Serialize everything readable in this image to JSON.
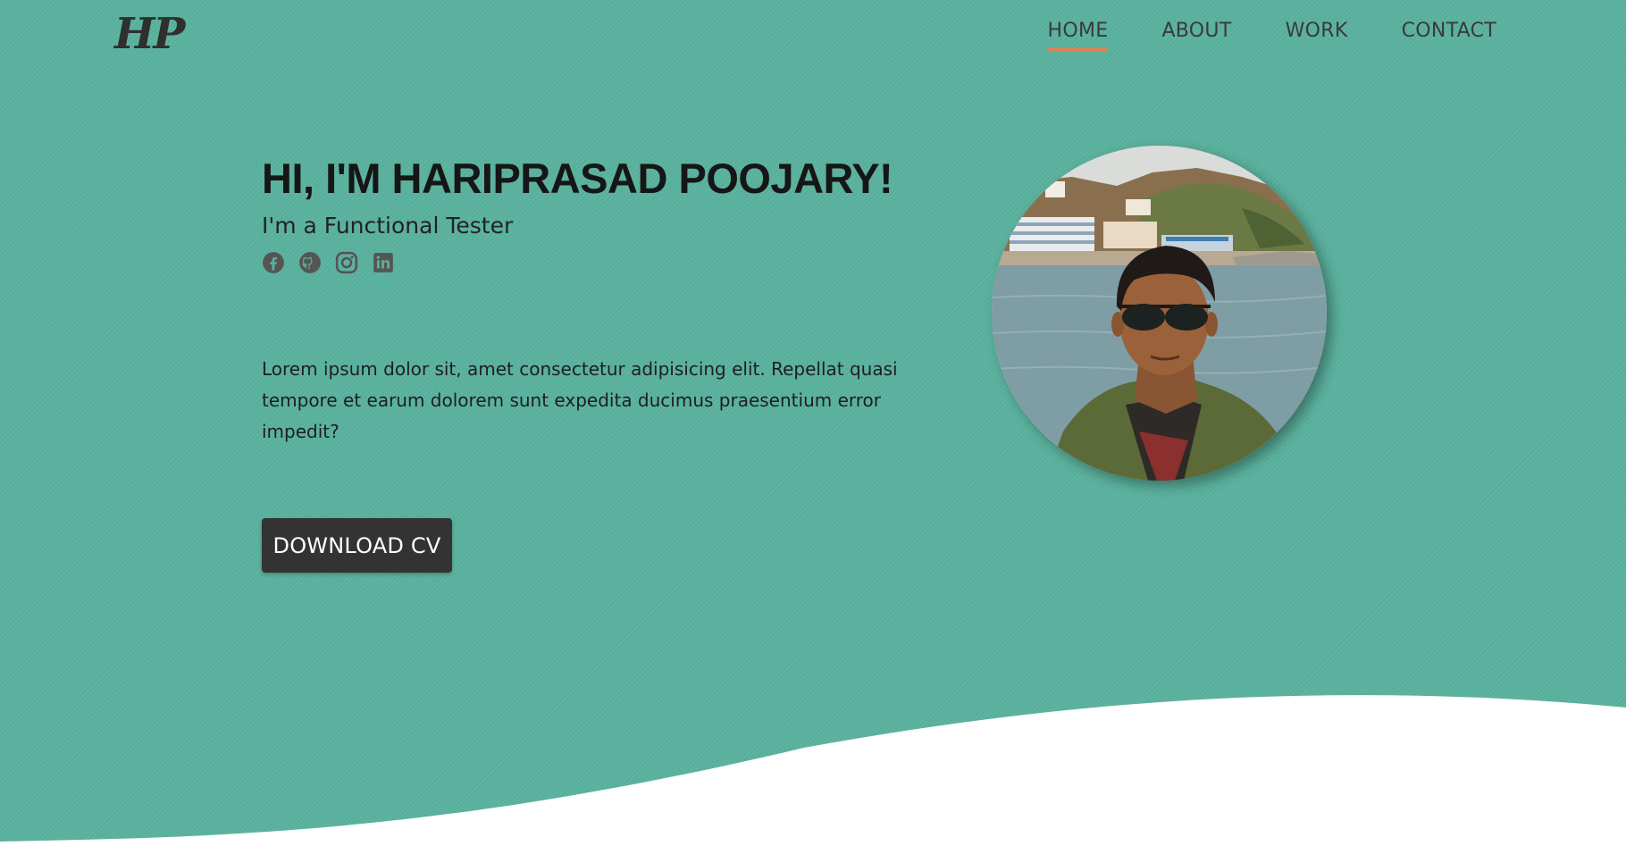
{
  "brand": {
    "logo_text": "HP"
  },
  "nav": {
    "items": [
      {
        "label": "HOME",
        "active": true
      },
      {
        "label": "ABOUT",
        "active": false
      },
      {
        "label": "WORK",
        "active": false
      },
      {
        "label": "CONTACT",
        "active": false
      }
    ]
  },
  "hero": {
    "title": "HI, I'M HARIPRASAD POOJARY!",
    "subtitle": "I'm a Functional Tester",
    "description": "Lorem ipsum dolor sit, amet consectetur adipisicing elit. Repellat quasi tempore et earum dolorem sunt expedita ducimus praesentium error impedit?",
    "cta_label": "DOWNLOAD CV"
  },
  "socials": [
    {
      "icon": "facebook-icon"
    },
    {
      "icon": "github-icon"
    },
    {
      "icon": "instagram-icon"
    },
    {
      "icon": "linkedin-icon"
    }
  ],
  "colors": {
    "background": "#58b09c",
    "text_dark": "#161616",
    "button": "#333333",
    "nav_active_underline": "#e67e50",
    "icon": "#555555"
  }
}
